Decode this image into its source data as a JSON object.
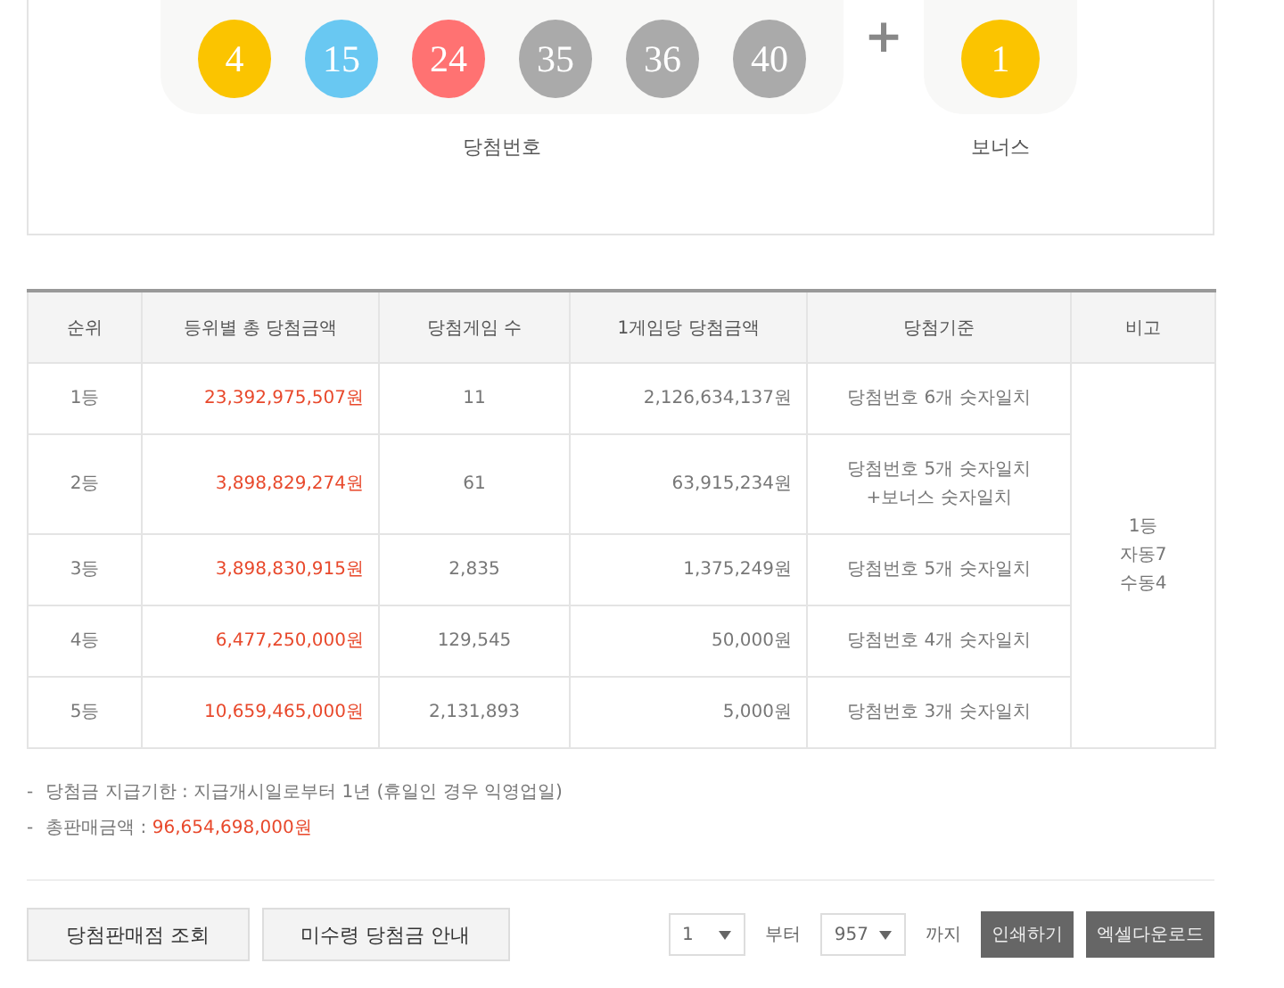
{
  "winning_numbers": {
    "label": "당첨번호",
    "balls": [
      {
        "number": "4",
        "color": "#fbc400"
      },
      {
        "number": "15",
        "color": "#69c8f2"
      },
      {
        "number": "24",
        "color": "#ff7272"
      },
      {
        "number": "35",
        "color": "#aaaaaa"
      },
      {
        "number": "36",
        "color": "#aaaaaa"
      },
      {
        "number": "40",
        "color": "#aaaaaa"
      }
    ]
  },
  "plus": "+",
  "bonus": {
    "label": "보너스",
    "balls": [
      {
        "number": "1",
        "color": "#fbc400"
      }
    ]
  },
  "table": {
    "columns": [
      "순위",
      "등위별 총 당첨금액",
      "당첨게임 수",
      "1게임당 당첨금액",
      "당첨기준",
      "비고"
    ],
    "rows": [
      {
        "rank": "1등",
        "total": "23,392,975,507원",
        "games": "11",
        "per_game": "2,126,634,137원",
        "criteria": [
          "당첨번호 6개 숫자일치"
        ]
      },
      {
        "rank": "2등",
        "total": "3,898,829,274원",
        "games": "61",
        "per_game": "63,915,234원",
        "criteria": [
          "당첨번호 5개 숫자일치",
          "+보너스 숫자일치"
        ]
      },
      {
        "rank": "3등",
        "total": "3,898,830,915원",
        "games": "2,835",
        "per_game": "1,375,249원",
        "criteria": [
          "당첨번호 5개 숫자일치"
        ]
      },
      {
        "rank": "4등",
        "total": "6,477,250,000원",
        "games": "129,545",
        "per_game": "50,000원",
        "criteria": [
          "당첨번호 4개 숫자일치"
        ]
      },
      {
        "rank": "5등",
        "total": "10,659,465,000원",
        "games": "2,131,893",
        "per_game": "5,000원",
        "criteria": [
          "당첨번호 3개 숫자일치"
        ]
      }
    ],
    "note": [
      "1등",
      "자동7",
      "수동4"
    ]
  },
  "notes": [
    {
      "bullet": "-",
      "label": "당첨금 지급기한 : 지급개시일로부터 1년 (휴일인 경우 익영업일)"
    },
    {
      "bullet": "-",
      "label": "총판매금액 : ",
      "value": "96,654,698,000원"
    }
  ],
  "buttons": [
    "당첨판매점 조회",
    "미수령 당첨금 안내"
  ],
  "range": {
    "from": "1",
    "from_label": "부터",
    "to": "957",
    "to_label": "까지"
  },
  "actions": [
    "인쇄하기",
    "엑셀다운로드"
  ]
}
